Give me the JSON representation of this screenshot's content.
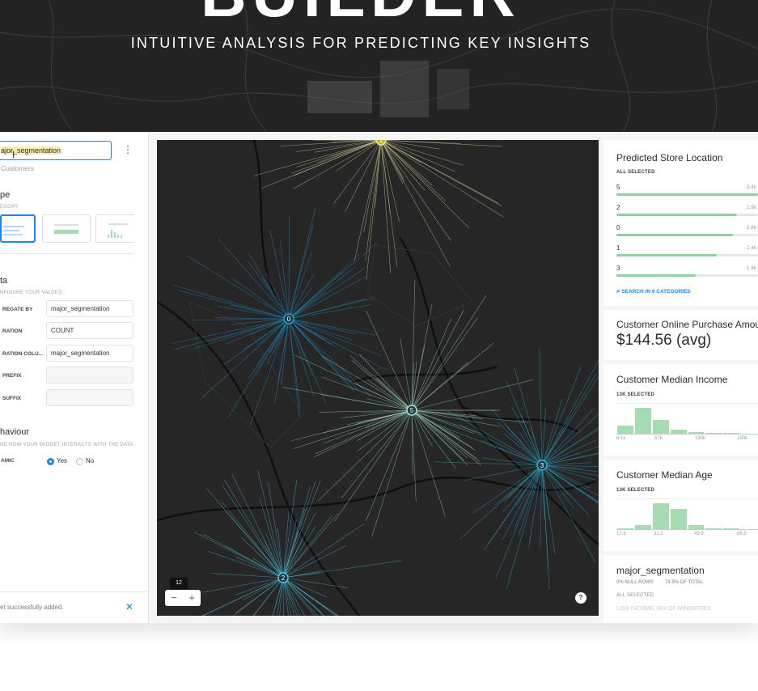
{
  "hero": {
    "title": "BUILDER",
    "subtitle": "INTUITIVE ANALYSIS FOR PREDICTING KEY INSIGHTS"
  },
  "sidebar": {
    "widget_name_selected": "ajor_segmentation",
    "widget_name_rest": "",
    "source_label": "Customers",
    "type_section": {
      "title": "pe",
      "subtitle": "EGORY"
    },
    "data_section": {
      "title": "ta",
      "subtitle": "NFIGURE YOUR VALUES",
      "rows": [
        {
          "label": "REGATE BY",
          "value": "major_segmentation"
        },
        {
          "label": "RATION",
          "value": "COUNT"
        },
        {
          "label": "RATION COLU...",
          "value": "major_segmentation"
        },
        {
          "label": "PREFIX",
          "value": ""
        },
        {
          "label": "SUFFIX",
          "value": ""
        }
      ]
    },
    "behaviour_section": {
      "title": "haviour",
      "subtitle": "NE HOW YOUR WIDGET INTERACTS WITH THE DATA",
      "dynamic_label": "AMIC",
      "yes_label": "Yes",
      "no_label": "No",
      "selected": "yes"
    },
    "toast": {
      "text": "et successfully added.",
      "close_icon": "close-icon"
    }
  },
  "map": {
    "zoom_level": "12",
    "zoom_out": "−",
    "zoom_in": "+",
    "help": "?",
    "clusters": [
      {
        "label": "1",
        "color": "#e8e3a8"
      },
      {
        "label": "0",
        "color": "#1e9bd7"
      },
      {
        "label": "5",
        "color": "#a9e6cf"
      },
      {
        "label": "3",
        "color": "#2bb3d9"
      },
      {
        "label": "2",
        "color": "#4fc3df"
      }
    ]
  },
  "widgets": {
    "store": {
      "title": "Predicted Store Location",
      "status": "ALL SELECTED",
      "categories": [
        {
          "name": "5",
          "value": "3.4k",
          "fraction": 1.0
        },
        {
          "name": "2",
          "value": "2.9k",
          "fraction": 0.853
        },
        {
          "name": "0",
          "value": "2.8k",
          "fraction": 0.824
        },
        {
          "name": "1",
          "value": "2.4k",
          "fraction": 0.706
        },
        {
          "name": "3",
          "value": "1.9k",
          "fraction": 0.559
        }
      ],
      "search_label": "SEARCH IN 6 CATEGORIES"
    },
    "purchase": {
      "title": "Customer Online Purchase Amount",
      "value": "$144.56 (avg)"
    },
    "income": {
      "title": "Customer Median Income",
      "status": "13K SELECTED",
      "ticks": [
        "6.1k",
        "67k",
        "130k",
        "190k"
      ],
      "bars": [
        0.28,
        0.9,
        0.47,
        0.14,
        0.06,
        0.03,
        0.02,
        0.01
      ]
    },
    "age": {
      "title": "Customer Median Age",
      "status": "13K SELECTED",
      "ticks": [
        "12.6",
        "31.2",
        "49.9",
        "68.5"
      ],
      "bars": [
        0.03,
        0.14,
        0.88,
        0.7,
        0.15,
        0.04,
        0.02,
        0.01
      ]
    },
    "segmentation": {
      "title": "major_segmentation",
      "null_rows": "0% NULL ROWS",
      "of_total": "74.5% OF TOTAL",
      "status": "ALL SELECTED",
      "first_item": "LOW INCOME, MIX OF MINORITIES"
    }
  },
  "colors": {
    "accent": "#1785fb",
    "bar_green": "#8fd1a0",
    "map_bg": "#262626"
  }
}
